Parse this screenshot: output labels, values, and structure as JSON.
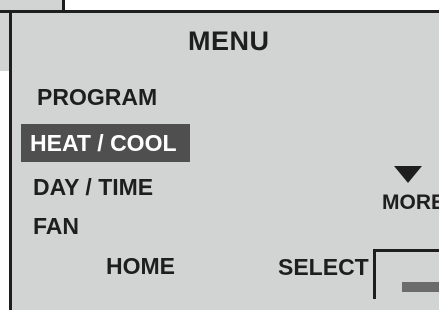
{
  "screen": {
    "title": "MENU"
  },
  "menu": {
    "items": [
      {
        "label": "PROGRAM",
        "selected": false
      },
      {
        "label": "HEAT / COOL",
        "selected": true
      },
      {
        "label": "DAY / TIME",
        "selected": false
      },
      {
        "label": "FAN",
        "selected": false
      }
    ]
  },
  "more": {
    "label": "MORE",
    "icon": "down-triangle-icon"
  },
  "soft_keys": {
    "home_label": "HOME",
    "select_label": "SELECT"
  },
  "colors": {
    "screen_background": "#d1d4d3",
    "highlight_background": "#4f4f4f",
    "text": "#1e1e1e",
    "highlight_text": "#ffffff"
  }
}
